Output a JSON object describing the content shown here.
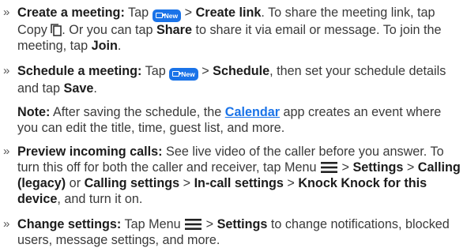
{
  "bullet": "»",
  "new_badge": "New",
  "items": [
    {
      "title": "Create a meeting:",
      "t1": " Tap ",
      "t2": " > ",
      "b1": "Create link",
      "t3": ". To share the meeting link, tap Copy ",
      "t4": ". Or you can tap ",
      "b2": "Share",
      "t5": " to share it via email or message. To join the meeting, tap ",
      "b3": "Join",
      "t6": "."
    },
    {
      "title": "Schedule a meeting:",
      "t1": " Tap ",
      "t2": " > ",
      "b1": "Schedule",
      "t3": ", then set your schedule details and tap ",
      "b2": "Save",
      "t4": "."
    },
    {
      "note_label": "Note:",
      "t1": " After saving the schedule, the ",
      "link": "Calendar",
      "t2": " app creates an event where you can edit the title, time, guest list, and more."
    },
    {
      "title": "Preview incoming calls:",
      "t1": " See live video of the caller before you answer. To turn this off for both the caller and receiver, tap Menu ",
      "t2": " > ",
      "b1": "Settings",
      "t3": " > ",
      "b2": "Calling (legacy)",
      "t4": " or ",
      "b3": "Calling settings",
      "t5": " > ",
      "b4": "In-call settings",
      "t6": " > ",
      "b5": "Knock Knock for this device",
      "t7": ", and turn it on."
    },
    {
      "title": "Change settings:",
      "t1": " Tap Menu ",
      "t2": " > ",
      "b1": "Settings",
      "t3": " to change notifications, blocked users, message settings, and more."
    }
  ],
  "colors": {
    "accent": "#1a73e8",
    "text": "#3a3a3a",
    "bold": "#1c1c1c"
  }
}
